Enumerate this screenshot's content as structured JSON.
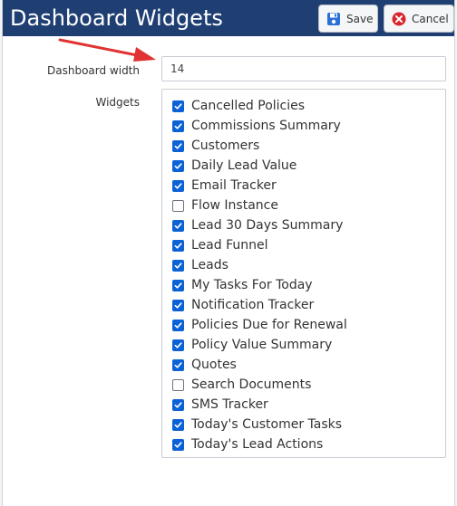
{
  "dialog": {
    "title": "Dashboard Widgets",
    "save_label": "Save",
    "cancel_label": "Cancel"
  },
  "form": {
    "width_label": "Dashboard width",
    "width_value": "14",
    "widgets_label": "Widgets"
  },
  "widgets": [
    {
      "label": "Cancelled Policies",
      "checked": true
    },
    {
      "label": "Commissions Summary",
      "checked": true
    },
    {
      "label": "Customers",
      "checked": true
    },
    {
      "label": "Daily Lead Value",
      "checked": true
    },
    {
      "label": "Email Tracker",
      "checked": true
    },
    {
      "label": "Flow Instance",
      "checked": false
    },
    {
      "label": "Lead 30 Days Summary",
      "checked": true
    },
    {
      "label": "Lead Funnel",
      "checked": true
    },
    {
      "label": "Leads",
      "checked": true
    },
    {
      "label": "My Tasks For Today",
      "checked": true
    },
    {
      "label": "Notification Tracker",
      "checked": true
    },
    {
      "label": "Policies Due for Renewal",
      "checked": true
    },
    {
      "label": "Policy Value Summary",
      "checked": true
    },
    {
      "label": "Quotes",
      "checked": true
    },
    {
      "label": "Search Documents",
      "checked": false
    },
    {
      "label": "SMS Tracker",
      "checked": true
    },
    {
      "label": "Today's Customer Tasks",
      "checked": true
    },
    {
      "label": "Today's Lead Actions",
      "checked": true
    }
  ],
  "icons": {
    "save": "floppy-disk-icon",
    "cancel": "cancel-circle-icon",
    "annotation": "red-arrow-icon"
  },
  "colors": {
    "header": "#1f3f73",
    "checkbox_checked": "#0b62d6",
    "cancel_icon": "#d9262c",
    "annotation_arrow": "#e03232"
  }
}
